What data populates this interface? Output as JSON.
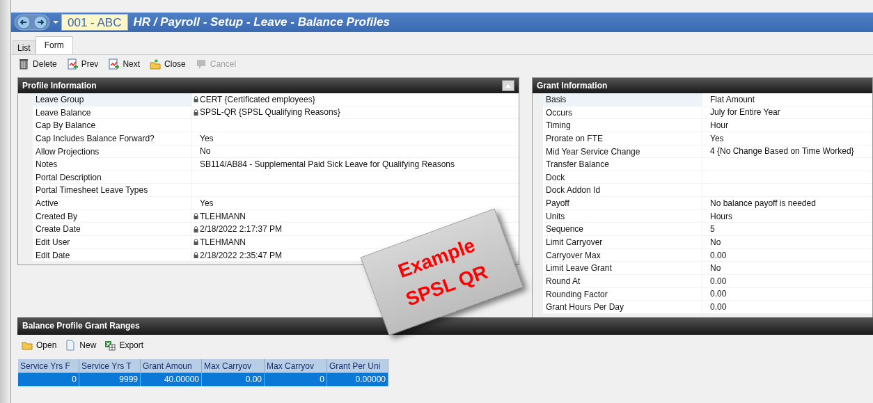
{
  "window": {
    "company": "001 - ABC",
    "title": "HR / Payroll - Setup - Leave - Balance Profiles"
  },
  "tabs": [
    {
      "label": "List",
      "selected": false
    },
    {
      "label": "Form",
      "selected": true
    }
  ],
  "toolbar": [
    {
      "label": "Delete",
      "disabled": false
    },
    {
      "label": "Prev",
      "disabled": false
    },
    {
      "label": "Next",
      "disabled": false
    },
    {
      "label": "Close",
      "disabled": false
    },
    {
      "label": "Cancel",
      "disabled": true
    }
  ],
  "profile_information": {
    "title": "Profile Information",
    "fields": [
      {
        "label": "Leave Group",
        "value": "CERT {Certificated employees}",
        "locked": true,
        "selected": true
      },
      {
        "label": "Leave Balance",
        "value": "SPSL-QR {SPSL Qualifying Reasons}",
        "locked": true,
        "selected": false
      },
      {
        "label": "Cap By Balance",
        "locked": false,
        "selected": false
      },
      {
        "label": "Cap Includes Balance Forward?",
        "value": "Yes",
        "locked": false,
        "selected": false
      },
      {
        "label": "Allow Projections",
        "value": "No",
        "locked": false,
        "selected": false
      },
      {
        "label": "Notes",
        "value": "SB114/AB84 - Supplemental Paid Sick Leave for Qualifying Reasons",
        "locked": false,
        "selected": false
      },
      {
        "label": "Portal Description",
        "locked": false,
        "selected": false
      },
      {
        "label": "Portal Timesheet Leave Types",
        "locked": false,
        "selected": false
      },
      {
        "label": "Active",
        "value": "Yes",
        "locked": false,
        "selected": false
      },
      {
        "label": "Created By",
        "value": "TLEHMANN",
        "locked": true,
        "selected": false
      },
      {
        "label": "Create Date",
        "value": "2/18/2022 2:17:37 PM",
        "locked": true,
        "selected": false
      },
      {
        "label": "Edit User",
        "value": "TLEHMANN",
        "locked": true,
        "selected": false
      },
      {
        "label": "Edit Date",
        "value": "2/18/2022 2:35:47 PM",
        "locked": true,
        "selected": false
      }
    ]
  },
  "grant_information": {
    "title": "Grant Information",
    "fields": [
      {
        "label": "Basis",
        "value": "Flat Amount",
        "selected": true
      },
      {
        "label": "Occurs",
        "value": "July for Entire Year",
        "selected": false
      },
      {
        "label": "Timing",
        "value": "Hour",
        "selected": false
      },
      {
        "label": "Prorate on FTE",
        "value": "Yes",
        "selected": false
      },
      {
        "label": "Mid Year Service Change",
        "value": "4 {No Change Based on Time Worked}",
        "selected": false
      },
      {
        "label": "Transfer Balance",
        "selected": false
      },
      {
        "label": "Dock",
        "selected": false
      },
      {
        "label": "Dock Addon Id",
        "selected": false
      },
      {
        "label": "Payoff",
        "value": "No balance payoff is needed",
        "selected": false
      },
      {
        "label": "Units",
        "value": "Hours",
        "selected": false
      },
      {
        "label": "Sequence",
        "value": "5",
        "selected": false
      },
      {
        "label": "Limit Carryover",
        "value": "No",
        "selected": false
      },
      {
        "label": "Carryover Max",
        "value": "0.00",
        "selected": false
      },
      {
        "label": "Limit Leave Grant",
        "value": "No",
        "selected": false
      },
      {
        "label": "Round At",
        "value": "0.00",
        "selected": false
      },
      {
        "label": "Rounding Factor",
        "value": "0.00",
        "selected": false
      },
      {
        "label": "Grant Hours Per Day",
        "value": "0.00",
        "selected": false
      }
    ]
  },
  "grant_ranges": {
    "title": "Balance Profile Grant Ranges",
    "toolbar": [
      {
        "label": "Open"
      },
      {
        "label": "New"
      },
      {
        "label": "Export"
      }
    ],
    "columns": [
      "Service Yrs F",
      "Service Yrs T",
      "Grant Amoun",
      "Max Carryov",
      "Max Carryov",
      "Grant Per Uni"
    ],
    "rows": [
      {
        "cells": [
          "0",
          "9999",
          "40.00000",
          "0.00",
          "0",
          "0.00000"
        ],
        "selected": true
      }
    ]
  },
  "note": {
    "lines": [
      "Example",
      "SPSL QR"
    ]
  }
}
